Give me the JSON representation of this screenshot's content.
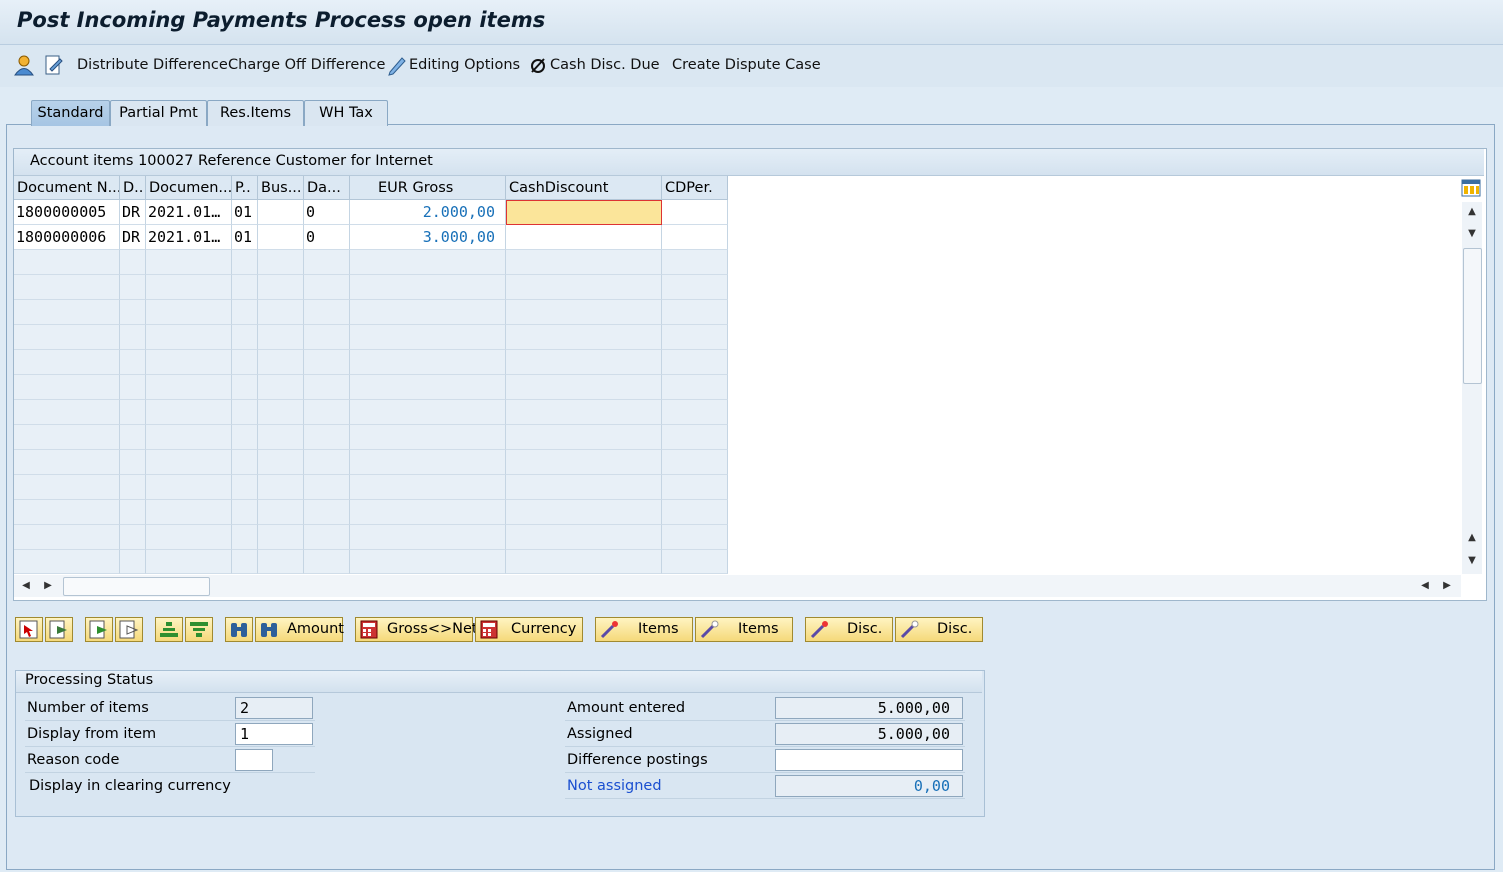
{
  "window": {
    "title": "Post Incoming Payments Process open items"
  },
  "toolbar": {
    "distribute_difference": "Distribute Difference",
    "charge_off_difference": "Charge Off Difference",
    "editing_options": "Editing Options",
    "cash_disc_due": "Cash Disc. Due",
    "create_dispute_case": "Create Dispute Case"
  },
  "tabs": [
    {
      "label": "Standard",
      "active": true
    },
    {
      "label": "Partial Pmt",
      "active": false
    },
    {
      "label": "Res.Items",
      "active": false
    },
    {
      "label": "WH Tax",
      "active": false
    }
  ],
  "table": {
    "title": "Account items 100027 Reference Customer for Internet",
    "columns": [
      "Document N...",
      "D..",
      "Documen...",
      "P..",
      "Bus...",
      "Da...",
      "EUR Gross",
      "CashDiscount",
      "CDPer."
    ],
    "rows": [
      {
        "doc_no": "1800000005",
        "doc_type": "DR",
        "doc_date": "2021.01…",
        "posting_key": "01",
        "bus_area": "",
        "days": "0",
        "eur_gross": "2.000,00",
        "cash_discount": "",
        "cd_per": ""
      },
      {
        "doc_no": "1800000006",
        "doc_type": "DR",
        "doc_date": "2021.01…",
        "posting_key": "01",
        "bus_area": "",
        "days": "0",
        "eur_gross": "3.000,00",
        "cash_discount": "",
        "cd_per": ""
      }
    ]
  },
  "buttons": {
    "amount": "Amount",
    "gross_net": "Gross<>Net",
    "currency": "Currency",
    "items1": "Items",
    "items2": "Items",
    "disc1": "Disc.",
    "disc2": "Disc."
  },
  "processing_status": {
    "title": "Processing Status",
    "number_of_items_label": "Number of items",
    "number_of_items": "2",
    "display_from_item_label": "Display from item",
    "display_from_item": "1",
    "reason_code_label": "Reason code",
    "reason_code": "",
    "display_clearing_currency_label": "Display in clearing currency",
    "amount_entered_label": "Amount entered",
    "amount_entered": "5.000,00",
    "assigned_label": "Assigned",
    "assigned": "5.000,00",
    "difference_postings_label": "Difference postings",
    "difference_postings": "",
    "not_assigned_label": "Not assigned",
    "not_assigned": "0,00"
  },
  "colors": {
    "accent": "#1870b8",
    "highlight_cell": "#fbe59a",
    "button": "#f5d97a"
  }
}
